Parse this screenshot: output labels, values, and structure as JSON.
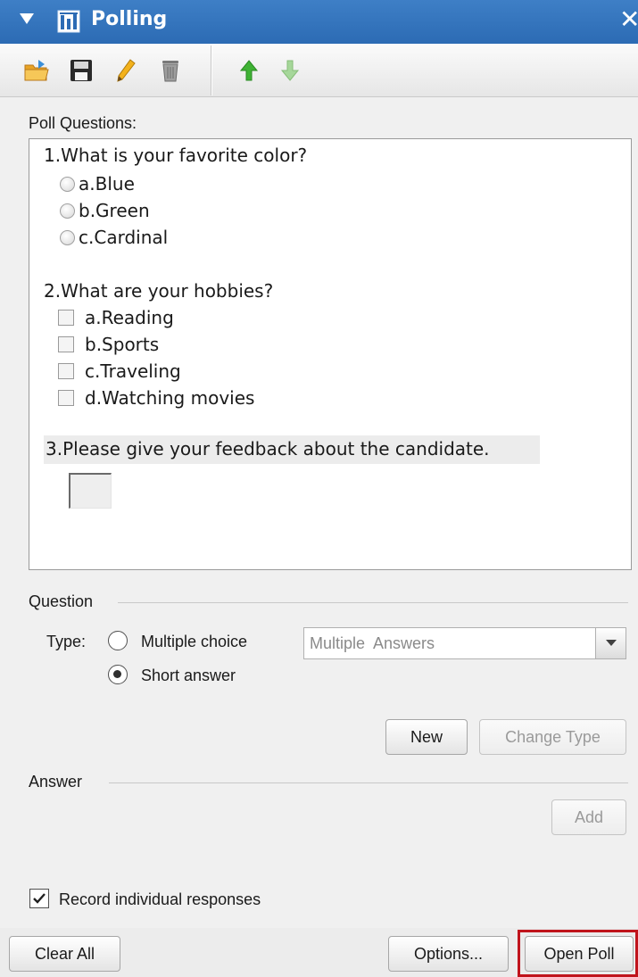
{
  "window": {
    "title": "Polling",
    "close_glyph": "✕"
  },
  "toolbar": {
    "tools": [
      "open-poll-icon",
      "save-icon",
      "edit-icon",
      "delete-icon",
      "move-up-icon",
      "move-down-icon"
    ]
  },
  "poll_questions": {
    "label": "Poll Questions:",
    "questions": [
      {
        "text": "1.What is your favorite color?",
        "type": "single",
        "options": [
          "a.Blue",
          "b.Green",
          "c.Cardinal"
        ]
      },
      {
        "text": "2.What are your hobbies?",
        "type": "multiple",
        "options": [
          "a.Reading",
          "b.Sports",
          "c.Traveling",
          "d.Watching movies"
        ]
      },
      {
        "text": "3.Please give your feedback about the candidate.",
        "type": "short"
      }
    ]
  },
  "question_section": {
    "title": "Question",
    "type_label": "Type:",
    "type_options": [
      "Multiple choice",
      "Short answer"
    ],
    "selected_type": "Short answer",
    "answers_select": "Multiple  Answers",
    "new_button": "New",
    "change_type_button": "Change Type"
  },
  "answer_section": {
    "title": "Answer",
    "add_button": "Add"
  },
  "record_responses": {
    "label": "Record individual responses",
    "checked": true
  },
  "footer": {
    "clear_all": "Clear All",
    "options": "Options...",
    "open_poll": "Open Poll"
  },
  "colors": {
    "titlebar": "#2f6fb7",
    "highlight": "#c0141c"
  }
}
